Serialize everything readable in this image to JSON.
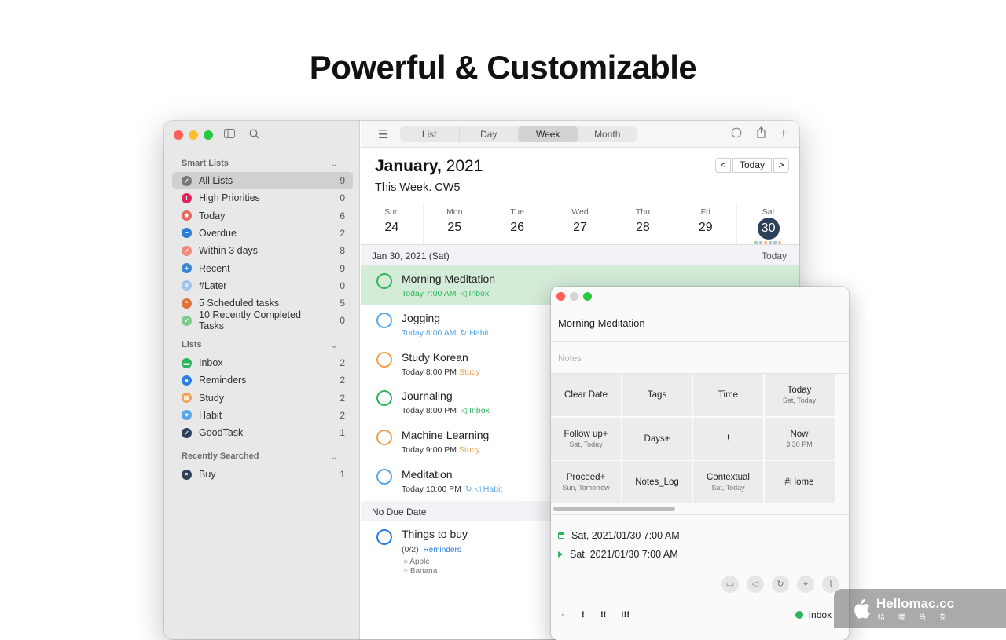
{
  "headline": "Powerful & Customizable",
  "sidebar": {
    "smart_lists_header": "Smart Lists",
    "smart_lists": [
      {
        "label": "All Lists",
        "count": "9",
        "icon": "checkmark-circle-icon",
        "color": "#7a7a7a",
        "active": true
      },
      {
        "label": "High Priorities",
        "count": "0",
        "icon": "exclamation-icon",
        "color": "#e0245e"
      },
      {
        "label": "Today",
        "count": "6",
        "icon": "star-icon",
        "color": "#e5675a"
      },
      {
        "label": "Overdue",
        "count": "2",
        "icon": "wave-icon",
        "color": "#2c7fd0"
      },
      {
        "label": "Within 3 days",
        "count": "8",
        "icon": "check-icon",
        "color": "#ee8a7a"
      },
      {
        "label": "Recent",
        "count": "9",
        "icon": "plus-icon",
        "color": "#3a86d6"
      },
      {
        "label": "#Later",
        "count": "0",
        "icon": "hash-icon",
        "color": "#9fc3ea"
      },
      {
        "label": "5 Scheduled tasks",
        "count": "5",
        "icon": "asterisk-icon",
        "color": "#e2733b"
      },
      {
        "label": "10 Recently Completed Tasks",
        "count": "0",
        "icon": "check-icon",
        "color": "#7cc98a"
      }
    ],
    "lists_header": "Lists",
    "lists": [
      {
        "label": "Inbox",
        "count": "2",
        "icon": "inbox-icon",
        "color": "#2db55d"
      },
      {
        "label": "Reminders",
        "count": "2",
        "icon": "dot-icon",
        "color": "#2b7de0"
      },
      {
        "label": "Study",
        "count": "2",
        "icon": "book-icon",
        "color": "#f0a050"
      },
      {
        "label": "Habit",
        "count": "2",
        "icon": "heart-icon",
        "color": "#5aa7e8"
      },
      {
        "label": "GoodTask",
        "count": "1",
        "icon": "check-icon",
        "color": "#2d4159"
      }
    ],
    "searched_header": "Recently Searched",
    "searched": [
      {
        "label": "Buy",
        "count": "1",
        "icon": "search-icon",
        "color": "#2d4159"
      }
    ]
  },
  "toolbar": {
    "tabs": [
      "List",
      "Day",
      "Week",
      "Month"
    ],
    "selected_tab": "Week"
  },
  "header": {
    "month": "January,",
    "year": "2021",
    "week": "This Week. CW5",
    "today_button": "Today",
    "prev": "<",
    "next": ">"
  },
  "days": [
    {
      "name": "Sun",
      "num": "24"
    },
    {
      "name": "Mon",
      "num": "25"
    },
    {
      "name": "Tue",
      "num": "26"
    },
    {
      "name": "Wed",
      "num": "27"
    },
    {
      "name": "Thu",
      "num": "28"
    },
    {
      "name": "Fri",
      "num": "29"
    },
    {
      "name": "Sat",
      "num": "30",
      "today": true
    }
  ],
  "date_header": {
    "label": "Jan 30, 2021 (Sat)",
    "right": "Today"
  },
  "tasks": [
    {
      "title": "Morning Meditation",
      "time": "Today 7:00 AM",
      "list": "Inbox",
      "list_color": "#2db55d",
      "time_color": "#2db55d",
      "circle": "#2db55d",
      "list_icon": "speaker-icon",
      "highlight": true
    },
    {
      "title": "Jogging",
      "time": "Today 8:00 AM",
      "list": "Habit",
      "list_color": "#5aa7e8",
      "time_color": "#5aa7e8",
      "circle": "#5aa7e8",
      "list_icon": "repeat-icon"
    },
    {
      "title": "Study Korean",
      "time": "Today 8:00 PM",
      "list": "Study",
      "list_color": "#f0a050",
      "time_color": "#333333",
      "circle": "#f0a050",
      "list_icon": ""
    },
    {
      "title": "Journaling",
      "time": "Today 8:00 PM",
      "list": "Inbox",
      "list_color": "#2db55d",
      "time_color": "#333333",
      "circle": "#2db55d",
      "list_icon": "speaker-icon"
    },
    {
      "title": "Machine Learning",
      "time": "Today 9:00 PM",
      "list": "Study",
      "list_color": "#f0a050",
      "time_color": "#333333",
      "circle": "#f0a050",
      "list_icon": ""
    },
    {
      "title": "Meditation",
      "time": "Today 10:00 PM",
      "list": "Habit",
      "list_color": "#5aa7e8",
      "time_color": "#333333",
      "circle": "#5aa7e8",
      "list_icon": "repeat-speaker-icon"
    }
  ],
  "no_due": {
    "label": "No Due Date",
    "task": {
      "title": "Things to buy",
      "progress": "(0/2)",
      "list": "Reminders",
      "list_color": "#2b7de0",
      "circle": "#2b7de0"
    },
    "subitems": [
      "Apple",
      "Banana"
    ]
  },
  "popup": {
    "title": "Morning Meditation",
    "notes_placeholder": "Notes",
    "actions": [
      {
        "main": "Clear Date",
        "sub": ""
      },
      {
        "main": "Tags",
        "sub": ""
      },
      {
        "main": "Time",
        "sub": ""
      },
      {
        "main": "Today",
        "sub": "Sat, Today"
      },
      {
        "main": "Follow up+",
        "sub": "Sat, Today"
      },
      {
        "main": "Days+",
        "sub": ""
      },
      {
        "main": "!",
        "sub": ""
      },
      {
        "main": "Now",
        "sub": "3:30 PM"
      },
      {
        "main": "Proceed+",
        "sub": "Sun, Tomorrow"
      },
      {
        "main": "Notes_Log",
        "sub": ""
      },
      {
        "main": "Contextual",
        "sub": "Sat, Today"
      },
      {
        "main": "#Home",
        "sub": ""
      }
    ],
    "due": "Sat, 2021/01/30 7:00 AM",
    "alert": "Sat, 2021/01/30 7:00 AM",
    "priorities": [
      "·",
      "!",
      "!!",
      "!!!"
    ],
    "list": "Inbox",
    "list_color": "#2db55d"
  },
  "watermark": {
    "title": "Hellomac.cc",
    "sub": "哈喽马克"
  }
}
